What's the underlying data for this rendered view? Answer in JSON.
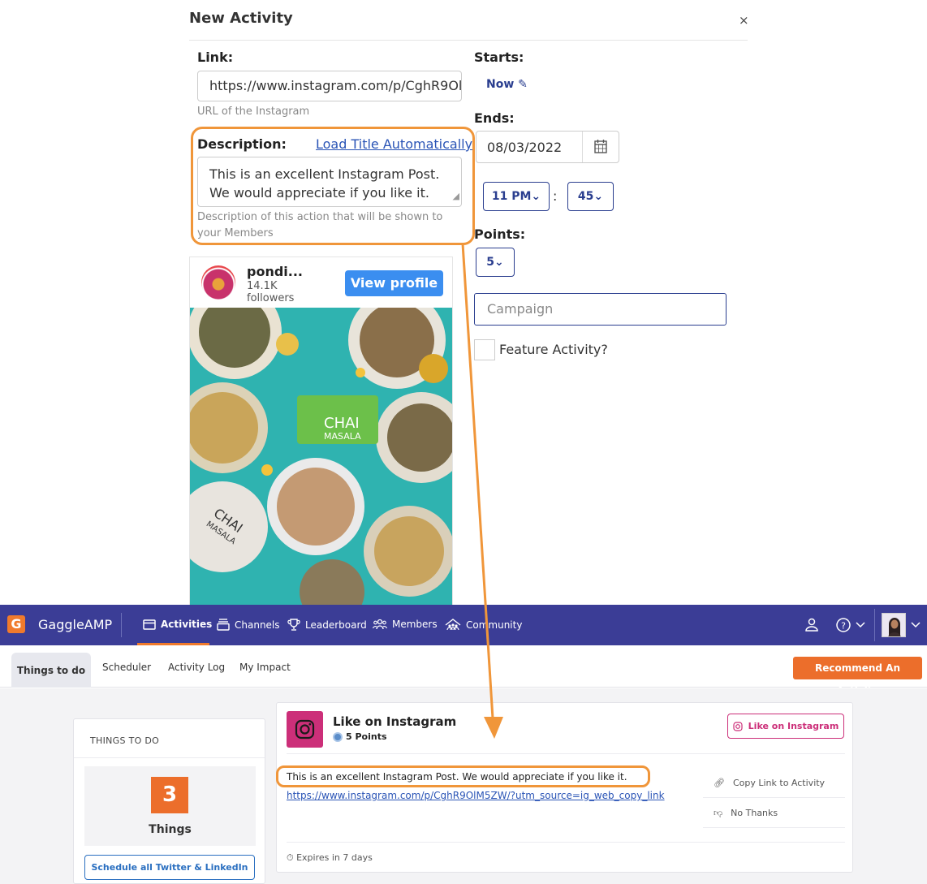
{
  "modal": {
    "title": "New Activity",
    "close": "×",
    "link_label": "Link:",
    "link_value": "https://www.instagram.com/p/CghR9Ol",
    "link_hint": "URL of the Instagram",
    "description_label": "Description:",
    "load_title_link": "Load Title Automatically",
    "description_value": "This is an excellent Instagram Post. We would appreciate if you like it.",
    "description_hint": "Description of this action that will be shown to your Members",
    "starts_label": "Starts:",
    "starts_value": "Now",
    "ends_label": "Ends:",
    "ends_date": "08/03/2022",
    "hour_select": "11 PM",
    "minute_select": "45",
    "time_separator": ":",
    "points_label": "Points:",
    "points_select": "5",
    "campaign_placeholder": "Campaign",
    "feature_label": "Feature Activity?",
    "feature_checked": false
  },
  "instagram_embed": {
    "username": "pondi...",
    "followers_count": "14.1K",
    "followers_label": "followers",
    "view_profile": "View profile",
    "photo_tin_label_1": "CHAI",
    "photo_tin_label_2": "MASALA",
    "photo_tin2_label_1": "CHAI",
    "photo_tin2_label_2": "MASALA",
    "button_color": "#3b8ef0"
  },
  "app": {
    "brand": "GaggleAMP",
    "logo_letter": "G",
    "nav": [
      {
        "label": "Activities",
        "icon": "window-icon"
      },
      {
        "label": "Channels",
        "icon": "channels-icon"
      },
      {
        "label": "Leaderboard",
        "icon": "trophy-icon"
      },
      {
        "label": "Members",
        "icon": "members-icon"
      },
      {
        "label": "Community",
        "icon": "community-icon"
      }
    ],
    "tabs": [
      "Things to do",
      "Scheduler",
      "Activity Log",
      "My Impact"
    ],
    "recommend_button": "Recommend An Activity",
    "nav_color": "#3b3d96",
    "accent_color": "#ec6e2b"
  },
  "todo": {
    "heading": "THINGS TO DO",
    "count": "3",
    "count_label": "Things",
    "schedule_button": "Schedule all Twitter & LinkedIn"
  },
  "activity_card": {
    "title": "Like on Instagram",
    "points": "5 Points",
    "action_button": "Like on Instagram",
    "description": "This is an excellent Instagram Post. We would appreciate if you like it.",
    "link": "https://www.instagram.com/p/CghR9OlM5ZW/?utm_source=ig_web_copy_link",
    "copy_link": "Copy Link to Activity",
    "no_thanks": "No Thanks",
    "expires": "Expires in 7 days",
    "instagram_color": "#cc2f79"
  },
  "annotation": {
    "highlight_color": "#f0963a"
  }
}
